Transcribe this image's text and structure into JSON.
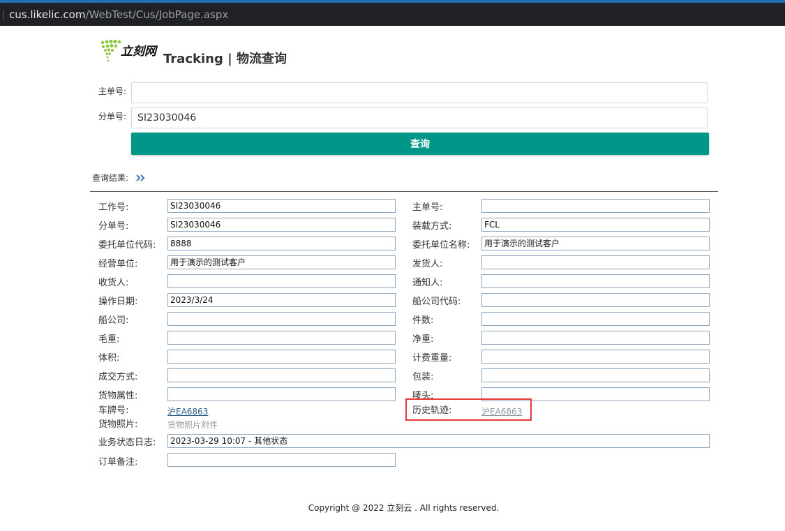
{
  "browser": {
    "url_host": "cus.likelic.com",
    "url_path": "/WebTest/Cus/JobPage.aspx"
  },
  "header": {
    "brand": "立刻网",
    "title": "Tracking | 物流查询",
    "accent_color": "#009688"
  },
  "query": {
    "master_label": "主单号:",
    "master_value": "",
    "house_label": "分单号:",
    "house_value": "SI23030046",
    "button_label": "查询"
  },
  "results": {
    "label": "查询结果:",
    "fields": {
      "job_no": {
        "label": "工作号:",
        "value": "SI23030046"
      },
      "master_no": {
        "label": "主单号:",
        "value": ""
      },
      "house_no": {
        "label": "分单号:",
        "value": "SI23030046"
      },
      "load_type": {
        "label": "装载方式:",
        "value": "FCL"
      },
      "client_code": {
        "label": "委托单位代码:",
        "value": "8888"
      },
      "client_name": {
        "label": "委托单位名称:",
        "value": "用于演示的测试客户"
      },
      "operator_unit": {
        "label": "经营单位:",
        "value": "用于演示的测试客户"
      },
      "shipper": {
        "label": "发货人:",
        "value": ""
      },
      "consignee": {
        "label": "收货人:",
        "value": ""
      },
      "notify": {
        "label": "通知人:",
        "value": ""
      },
      "op_date": {
        "label": "操作日期:",
        "value": "2023/3/24"
      },
      "carrier_code": {
        "label": "船公司代码:",
        "value": ""
      },
      "carrier": {
        "label": "船公司:",
        "value": ""
      },
      "pieces": {
        "label": "件数:",
        "value": ""
      },
      "gross_weight": {
        "label": "毛重:",
        "value": ""
      },
      "net_weight": {
        "label": "净重:",
        "value": ""
      },
      "volume": {
        "label": "体积:",
        "value": ""
      },
      "chargeable_weight": {
        "label": "计费重量:",
        "value": ""
      },
      "trade_terms": {
        "label": "成交方式:",
        "value": ""
      },
      "packing": {
        "label": "包装:",
        "value": ""
      },
      "cargo_attr": {
        "label": "货物属性:",
        "value": ""
      },
      "marks": {
        "label": "唛头:",
        "value": ""
      }
    },
    "plate": {
      "label": "车牌号:",
      "value": "沪EA6863"
    },
    "history": {
      "label": "历史轨迹:",
      "value": "沪EA6863"
    },
    "photos": {
      "label": "货物照片:",
      "value": "货物照片附件"
    },
    "status_log": {
      "label": "业务状态日志:",
      "value": "2023-03-29 10:07 - 其他状态"
    },
    "remarks": {
      "label": "订单备注:",
      "value": ""
    }
  },
  "footer": {
    "copyright": "Copyright @ 2022 立刻云 . All rights reserved."
  }
}
